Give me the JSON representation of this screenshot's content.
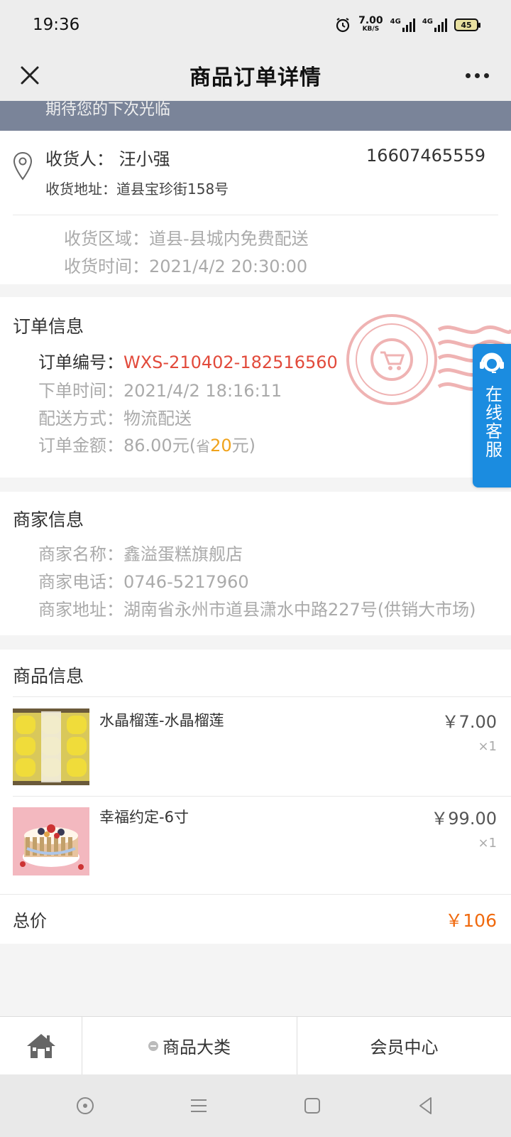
{
  "status_bar": {
    "time": "19:36",
    "net_speed_value": "7.00",
    "net_speed_unit": "KB/S",
    "signal1_label": "4G",
    "signal2_label": "4G",
    "battery": "45"
  },
  "nav": {
    "title": "商品订单详情"
  },
  "banner": {
    "text": "期待您的下次光临"
  },
  "address": {
    "receiver": "收货人： 汪小强",
    "phone": "16607465559",
    "address": "收货地址：道县宝珍街158号",
    "area": "收货区域：道县-县城内免费配送",
    "time": "收货时间：2021/4/2 20:30:00"
  },
  "order": {
    "title": "订单信息",
    "no_label": "订单编号：",
    "no_value": "WXS-210402-182516560",
    "created": "下单时间：2021/4/2 18:16:11",
    "delivery": "配送方式：物流配送",
    "amount_prefix": "订单金额：86.00元(",
    "amount_saved_label": "省",
    "amount_saved_value": "20",
    "amount_suffix": "元)"
  },
  "service": {
    "label": "在线客服"
  },
  "merchant": {
    "title": "商家信息",
    "name": "商家名称：鑫溢蛋糕旗舰店",
    "phone": "商家电话：0746-5217960",
    "address": "商家地址：湖南省永州市道县潇水中路227号(供销大市场)"
  },
  "goods": {
    "title": "商品信息",
    "items": [
      {
        "name": "水晶榴莲-水晶榴莲",
        "price": "￥7.00",
        "qty": "×1"
      },
      {
        "name": "幸福约定-6寸",
        "price": "￥99.00",
        "qty": "×1"
      }
    ],
    "total_label": "总价",
    "total_value": "￥106"
  },
  "tabbar": {
    "category": "商品大类",
    "member": "会员中心"
  },
  "colors": {
    "order_no": "#e24a3b",
    "saved": "#f0a31c",
    "total": "#f06a0f",
    "service_bg": "#1b8ce0",
    "banner_bg": "#7a8499"
  }
}
